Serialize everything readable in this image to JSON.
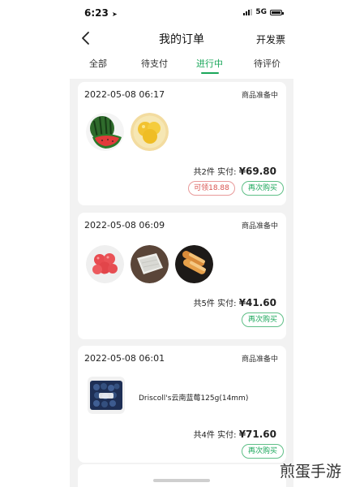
{
  "status_bar": {
    "time": "6:23",
    "network": "5G"
  },
  "nav": {
    "title": "我的订单",
    "right_label": "开发票",
    "back_icon": "chevron-left-icon"
  },
  "tabs": [
    {
      "label": "全部",
      "active": false
    },
    {
      "label": "待支付",
      "active": false
    },
    {
      "label": "进行中",
      "active": true
    },
    {
      "label": "待评价",
      "active": false
    }
  ],
  "accent_color": "#1aa75a",
  "orders": [
    {
      "date": "2022-05-08 06:17",
      "status": "商品准备中",
      "items": [
        "watermelon",
        "yellow-melon"
      ],
      "count_text": "共2件",
      "paid_label": "实付:",
      "amount": "¥69.80",
      "coupon_button": "可领18.88",
      "rebuy_button": "再次购买"
    },
    {
      "date": "2022-05-08 06:09",
      "status": "商品准备中",
      "items": [
        "tomatoes",
        "tofu",
        "fried-dough"
      ],
      "count_text": "共5件",
      "paid_label": "实付:",
      "amount": "¥41.60",
      "rebuy_button": "再次购买"
    },
    {
      "date": "2022-05-08 06:01",
      "status": "商品准备中",
      "items": [
        "blueberries"
      ],
      "product_name": "Driscoll's云南蓝莓125g(14mm)",
      "count_text": "共4件",
      "paid_label": "实付:",
      "amount": "¥71.60",
      "rebuy_button": "再次购买"
    }
  ],
  "watermark": "煎蛋手游"
}
